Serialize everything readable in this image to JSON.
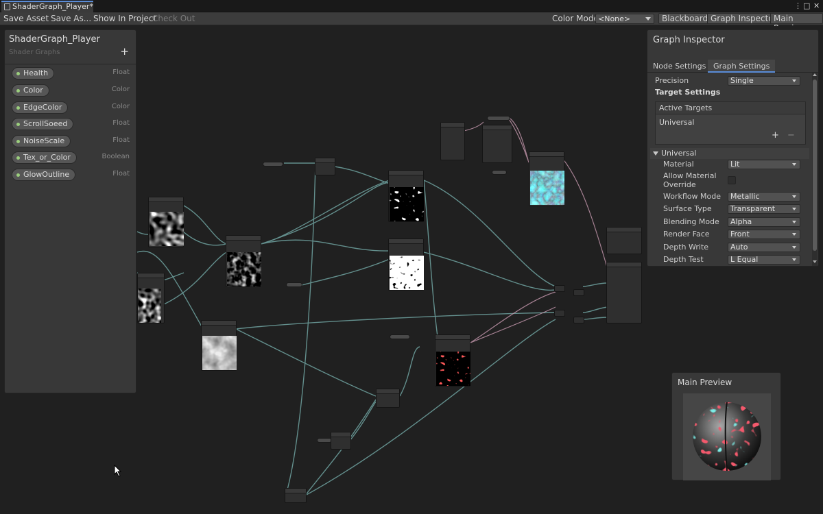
{
  "window": {
    "tab_title": "ShaderGraph_Player*",
    "controls": [
      "⋮",
      "□",
      "✕"
    ]
  },
  "toolbar": {
    "save_asset": "Save Asset",
    "save_as": "Save As...",
    "show_in_project": "Show In Project",
    "check_out": "Check Out",
    "color_mode_label": "Color Mode",
    "color_mode_value": "<None>",
    "blackboard": "Blackboard",
    "graph_inspector": "Graph Inspector",
    "main_preview": "Main Preview"
  },
  "blackboard": {
    "title": "ShaderGraph_Player",
    "subtitle": "Shader Graphs",
    "add_icon": "+",
    "properties": [
      {
        "name": "Health",
        "type": "Float"
      },
      {
        "name": "Color",
        "type": "Color"
      },
      {
        "name": "EdgeColor",
        "type": "Color"
      },
      {
        "name": "ScrollSoeed",
        "type": "Float"
      },
      {
        "name": "NoiseScale",
        "type": "Float"
      },
      {
        "name": "Tex_or_Color",
        "type": "Boolean"
      },
      {
        "name": "GlowOutline",
        "type": "Float"
      }
    ]
  },
  "inspector": {
    "title": "Graph Inspector",
    "tabs": [
      "Node Settings",
      "Graph Settings"
    ],
    "active_tab": "Graph Settings",
    "precision_label": "Precision",
    "precision_value": "Single",
    "target_settings": "Target Settings",
    "active_targets": "Active Targets",
    "target_item": "Universal",
    "add": "+",
    "remove": "−",
    "section": "Universal",
    "fields": [
      {
        "label": "Material",
        "value": "Lit"
      },
      {
        "label": "Allow Material Override",
        "value": ""
      },
      {
        "label": "Workflow Mode",
        "value": "Metallic"
      },
      {
        "label": "Surface Type",
        "value": "Transparent"
      },
      {
        "label": "Blending Mode",
        "value": "Alpha"
      },
      {
        "label": "Render Face",
        "value": "Front"
      },
      {
        "label": "Depth Write",
        "value": "Auto"
      },
      {
        "label": "Depth Test",
        "value": "L Equal"
      }
    ]
  },
  "preview": {
    "title": "Main Preview"
  },
  "colors": {
    "accent": "#5a8cd8",
    "wire": "#6fa3a0",
    "wire_pink": "#c89ab0",
    "property_dot": "#9ccf7e",
    "node_bg": "#2f2f2f",
    "canvas_bg": "#202020"
  },
  "icons": {
    "tab": "shadergraph-icon",
    "add": "plus-icon",
    "cursor": "mouse-pointer-icon"
  }
}
